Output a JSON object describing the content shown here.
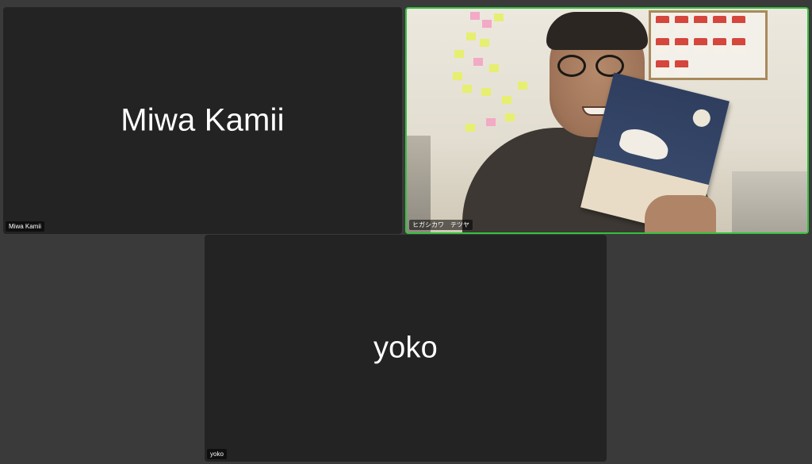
{
  "participants": [
    {
      "name": "Miwa Kamii",
      "tag": "Miwa Kamii",
      "video": false
    },
    {
      "name": "ヒガシカワ　テツヤ",
      "tag": "ヒガシカワ　テツヤ",
      "video": true,
      "active_speaker": true
    },
    {
      "name": "yoko",
      "tag": "yoko",
      "video": false
    }
  ],
  "colors": {
    "background": "#3a3a3a",
    "tile": "#232323",
    "active_border": "#35c13f",
    "text": "#ffffff"
  }
}
